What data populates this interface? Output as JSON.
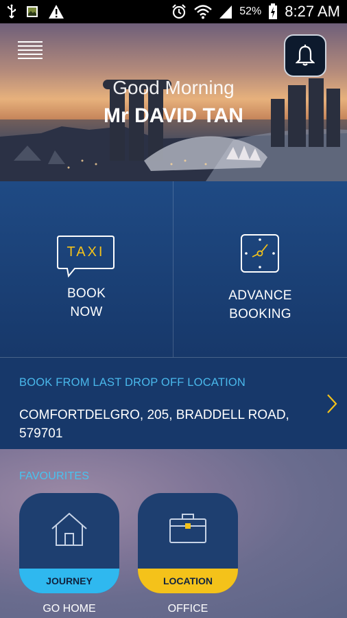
{
  "statusbar": {
    "battery": "52%",
    "time": "8:27 AM"
  },
  "hero": {
    "greeting": "Good Morning",
    "name": "Mr DAVID TAN"
  },
  "actions": {
    "book_now": {
      "badge": "TAXI",
      "line1": "BOOK",
      "line2": "NOW"
    },
    "advance": {
      "line1": "ADVANCE",
      "line2": "BOOKING"
    }
  },
  "last_drop": {
    "title": "BOOK FROM LAST DROP OFF LOCATION",
    "address": "COMFORTDELGRO, 205,  BRADDELL ROAD, 579701"
  },
  "favourites": {
    "title": "FAVOURITES",
    "items": [
      {
        "band": "JOURNEY",
        "label": "GO HOME",
        "band_color": "#2fb8ef",
        "icon": "house-icon"
      },
      {
        "band": "LOCATION",
        "label": "OFFICE",
        "band_color": "#f4c21a",
        "icon": "briefcase-icon"
      }
    ]
  },
  "colors": {
    "accent_blue": "#4ab9ec",
    "accent_yellow": "#f4c21a",
    "tile_blue": "#1f4a84"
  }
}
